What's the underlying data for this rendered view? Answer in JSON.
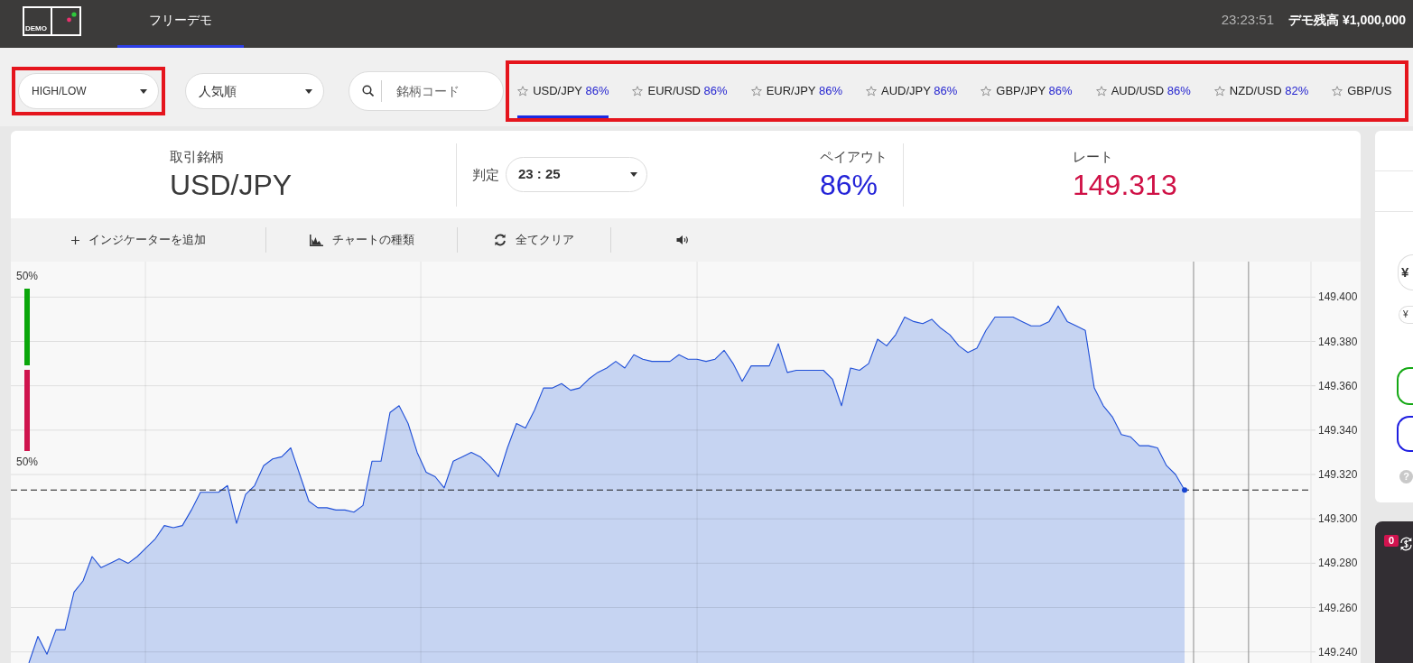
{
  "header": {
    "logo_text": "DEMO",
    "nav_tabs": [
      {
        "label": "フリーデモ",
        "selected": true
      }
    ],
    "clock": "23:23:51",
    "balance": "デモ残高 ¥1,000,000"
  },
  "filters": {
    "product_select": {
      "value": "HIGH/LOW",
      "highlighted": true
    },
    "sort_select": {
      "value": "人気順"
    },
    "search": {
      "placeholder": "銘柄コード"
    },
    "currency_tabs": {
      "highlighted": true,
      "items": [
        {
          "pair": "USD/JPY",
          "payout": "86%",
          "favorite": false,
          "selected": true
        },
        {
          "pair": "EUR/USD",
          "payout": "86%",
          "favorite": false,
          "selected": false
        },
        {
          "pair": "EUR/JPY",
          "payout": "86%",
          "favorite": false,
          "selected": false
        },
        {
          "pair": "AUD/JPY",
          "payout": "86%",
          "favorite": false,
          "selected": false
        },
        {
          "pair": "GBP/JPY",
          "payout": "86%",
          "favorite": false,
          "selected": false
        },
        {
          "pair": "AUD/USD",
          "payout": "86%",
          "favorite": false,
          "selected": false
        },
        {
          "pair": "NZD/USD",
          "payout": "82%",
          "favorite": false,
          "selected": false
        },
        {
          "pair": "GBP/US",
          "favorite": false,
          "selected": false
        }
      ]
    }
  },
  "trade_info": {
    "symbol_label": "取引銘柄",
    "symbol": "USD/JPY",
    "expiry_label": "判定",
    "expiry_select": "23 : 25",
    "payout_label": "ペイアウト",
    "payout": "86%",
    "rate_label": "レート",
    "rate": "149.313"
  },
  "chart_toolbar": [
    {
      "kind": "add",
      "label": "インジケーターを追加"
    },
    {
      "kind": "chart-type",
      "label": "チャートの種類"
    },
    {
      "kind": "clear",
      "label": "全てクリア"
    },
    {
      "kind": "sound"
    }
  ],
  "chart": {
    "sentiment": {
      "high_label": "50%",
      "low_label": "50%",
      "level": 0.5
    },
    "chart_data": {
      "type": "area",
      "grid": true,
      "ylim": [
        149.235,
        149.416
      ],
      "yticks": [
        {
          "value": 149.24,
          "label": "149.240"
        },
        {
          "value": 149.26,
          "label": "149.260"
        },
        {
          "value": 149.28,
          "label": "149.280"
        },
        {
          "value": 149.3,
          "label": "149.300"
        },
        {
          "value": 149.32,
          "label": "149.320"
        },
        {
          "value": 149.34,
          "label": "149.340"
        },
        {
          "value": 149.36,
          "label": "149.360"
        },
        {
          "value": 149.38,
          "label": "149.380"
        },
        {
          "value": 149.4,
          "label": "149.400"
        }
      ],
      "ref_lines": [
        {
          "axis": "y",
          "value": 149.313
        }
      ],
      "values": [
        149.235,
        149.247,
        149.239,
        149.25,
        149.25,
        149.267,
        149.272,
        149.283,
        149.278,
        149.28,
        149.282,
        149.28,
        149.283,
        149.287,
        149.291,
        149.297,
        149.296,
        149.297,
        149.304,
        149.312,
        149.312,
        149.312,
        149.315,
        149.298,
        149.311,
        149.315,
        149.324,
        149.327,
        149.328,
        149.332,
        149.32,
        149.308,
        149.305,
        149.305,
        149.304,
        149.304,
        149.303,
        149.306,
        149.326,
        149.326,
        149.348,
        149.351,
        149.343,
        149.33,
        149.321,
        149.319,
        149.314,
        149.326,
        149.328,
        149.33,
        149.328,
        149.324,
        149.319,
        149.332,
        149.343,
        149.341,
        149.349,
        149.359,
        149.359,
        149.361,
        149.358,
        149.359,
        149.363,
        149.366,
        149.368,
        149.371,
        149.368,
        149.374,
        149.372,
        149.371,
        149.371,
        149.371,
        149.374,
        149.372,
        149.372,
        149.371,
        149.372,
        149.376,
        149.37,
        149.362,
        149.369,
        149.369,
        149.369,
        149.379,
        149.366,
        149.367,
        149.367,
        149.367,
        149.367,
        149.363,
        149.351,
        149.368,
        149.367,
        149.37,
        149.381,
        149.378,
        149.383,
        149.391,
        149.389,
        149.388,
        149.39,
        149.386,
        149.383,
        149.378,
        149.375,
        149.377,
        149.385,
        149.391,
        149.391,
        149.391,
        149.389,
        149.387,
        149.387,
        149.389,
        149.396,
        149.389,
        149.387,
        149.385,
        149.359,
        149.351,
        149.346,
        149.338,
        149.337,
        149.333,
        149.333,
        149.332,
        149.324,
        149.32,
        149.313
      ]
    }
  },
  "side_panel": {
    "currency_button": "¥",
    "amount_chip": "¥",
    "option_buttons": [
      {
        "color": "#14a814"
      },
      {
        "color": "#1e1ee0"
      }
    ],
    "help": "?"
  },
  "positions_panel": {
    "badge": "0"
  }
}
